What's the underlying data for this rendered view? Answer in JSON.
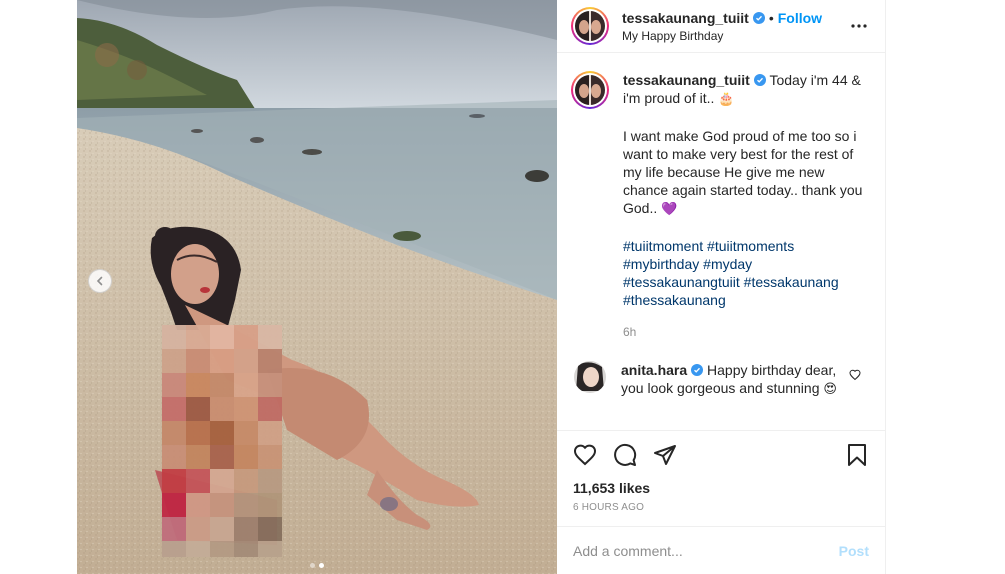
{
  "post": {
    "photo_description": "",
    "carousel": {
      "dots": 2,
      "active": 0
    }
  },
  "header": {
    "username": "tessakaunang_tuiit",
    "separator": "•",
    "follow_label": "Follow",
    "location": "My Happy Birthday"
  },
  "caption": {
    "username": "tessakaunang_tuiit",
    "line1": "Today i'm 44 & i'm proud of it..",
    "line1_emoji": "🎂",
    "para2": "I want make God proud of me too so i want to make very best for the rest of my life because He give me new chance again started today.. thank you God..",
    "para2_emoji": "💜",
    "hashtags": [
      "#tuiitmoment",
      "#tuiitmoments",
      "#mybirthday",
      "#myday",
      "#tessakaunangtuiit",
      "#tessakaunang",
      "#thessakaunang"
    ],
    "time": "6h"
  },
  "comment": {
    "username": "anita.hara",
    "text": "Happy birthday dear, you look gorgeous and stunning",
    "emoji": "😍"
  },
  "likes": "11,653 likes",
  "posted_ago": "6 HOURS AGO",
  "add_comment": {
    "placeholder": "Add a comment...",
    "post_label": "Post"
  },
  "colors": {
    "link_blue": "#0095f6",
    "hashtag": "#00376b",
    "muted": "#8e8e8e",
    "post_disabled": "#b2dffc"
  }
}
